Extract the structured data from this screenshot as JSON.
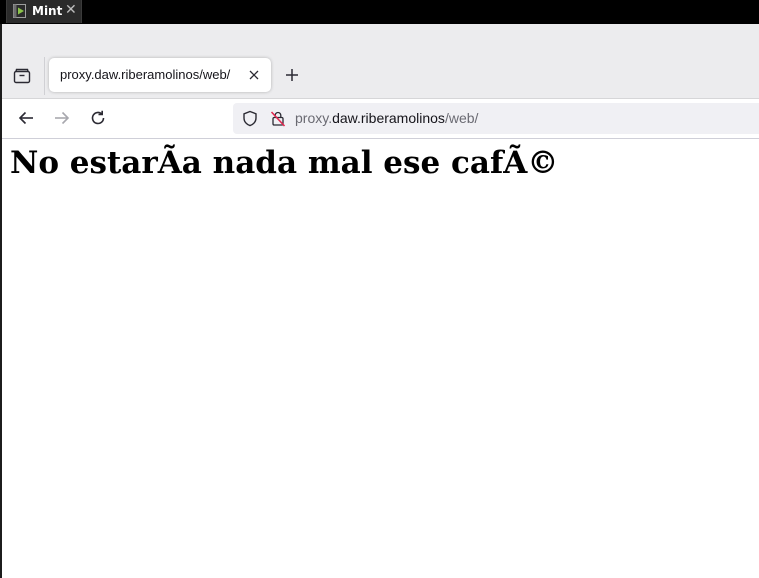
{
  "vm": {
    "tab_label": "Mint",
    "close_glyph": "✕",
    "icon": "vm-play-icon"
  },
  "browser": {
    "tabs": [
      {
        "label": "proxy.daw.riberamolinos/web/",
        "active": true
      }
    ],
    "tab_close_icon": "close-icon",
    "new_tab_icon": "plus-icon",
    "tab_overview_icon": "tab-overview-icon",
    "nav": {
      "back_icon": "arrow-left-icon",
      "forward_icon": "arrow-right-icon",
      "reload_icon": "reload-icon"
    },
    "url": {
      "prefix": "proxy.",
      "domain": "daw.riberamolinos",
      "path": "/web/",
      "shield_icon": "shield-icon",
      "insecure_icon": "insecure-lock-icon"
    }
  },
  "page": {
    "heading": "No estarÃa nada mal ese cafÃ©"
  },
  "colors": {
    "vm_bar": "#000000",
    "tabstrip": "#ececee",
    "urlbar": "#f0f0f4",
    "insecure_accent": "#e22850"
  }
}
